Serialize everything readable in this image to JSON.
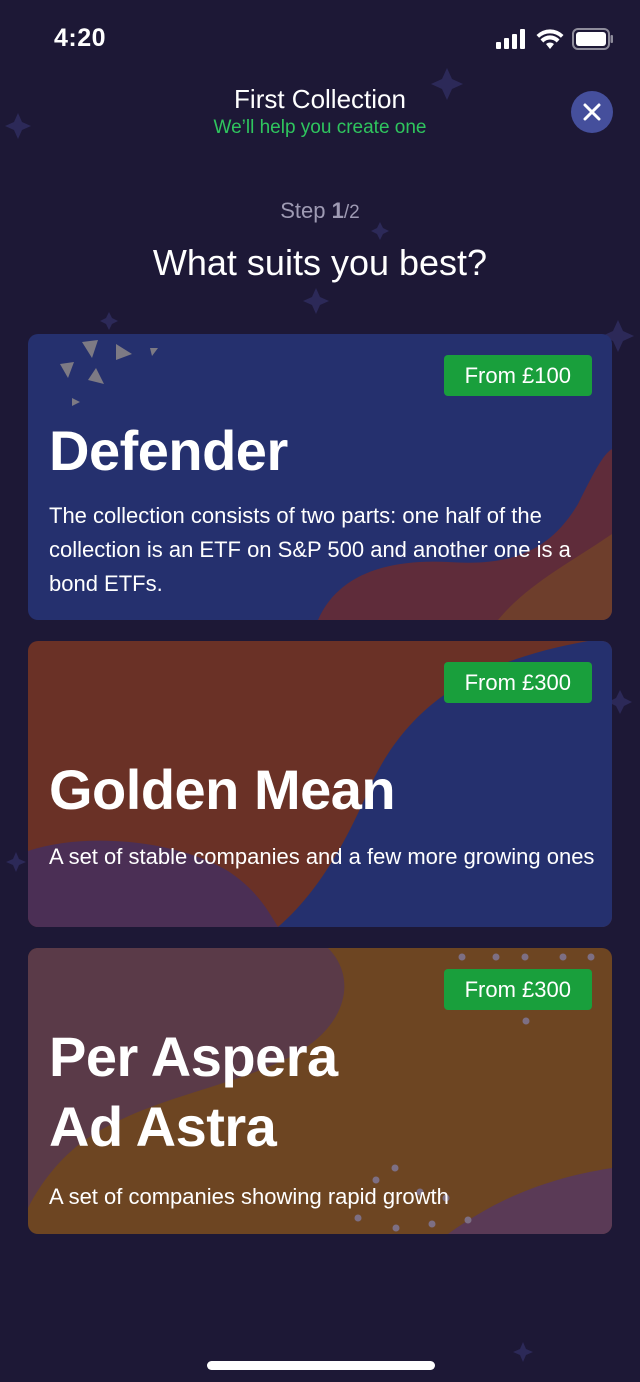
{
  "status_bar": {
    "time": "4:20",
    "icons": [
      "cellular-signal-icon",
      "wifi-icon",
      "battery-icon"
    ]
  },
  "header": {
    "title": "First Collection",
    "subtitle": "We’ll help you create one",
    "close_icon": "close-icon"
  },
  "step": {
    "label": "Step ",
    "current": "1",
    "total": "/2"
  },
  "question": "What suits you best?",
  "cards": [
    {
      "title": "Defender",
      "price": "From £100",
      "description": "The collection consists of two parts: one half of the collection is an ETF on S&P 500 and another one is a bond ETFs."
    },
    {
      "title": "Golden Mean",
      "price": "From £300",
      "description": "A set of stable companies and a few more growing ones"
    },
    {
      "title": "Per Aspera\nAd Astra",
      "price": "From £300",
      "description": "A set of companies showing rapid growth"
    }
  ],
  "colors": {
    "background": "#1d1836",
    "accent_green": "#2fc55e",
    "badge_green": "#199f3c",
    "close_button": "#454f9c",
    "card_blue": "#25306e",
    "card_red": "#6a3126",
    "card_orange": "#6d4522"
  }
}
